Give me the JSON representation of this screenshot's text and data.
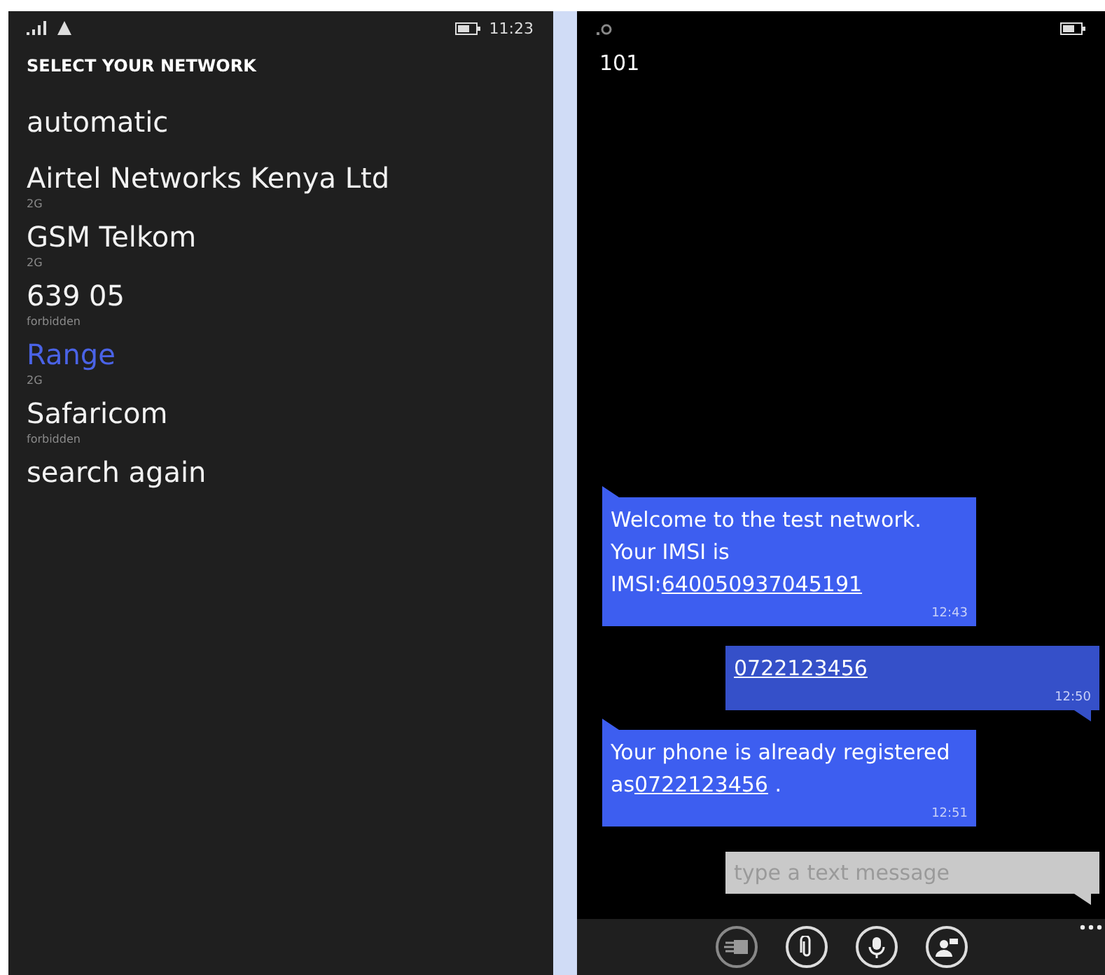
{
  "network_screen": {
    "status_bar": {
      "time": "11:23"
    },
    "title": "SELECT YOUR NETWORK",
    "networks": [
      {
        "name": "automatic",
        "selected": false
      },
      {
        "name": "Airtel Networks Kenya Ltd",
        "sub": "2G",
        "selected": false
      },
      {
        "name": "GSM Telkom",
        "sub": "2G",
        "selected": false
      },
      {
        "name": "639 05",
        "sub": "forbidden",
        "selected": false
      },
      {
        "name": "Range",
        "sub": "2G",
        "selected": true
      },
      {
        "name": "Safaricom",
        "sub": "forbidden",
        "selected": false
      },
      {
        "name": "search again",
        "selected": false
      }
    ]
  },
  "messaging_screen": {
    "contact": "101",
    "messages": [
      {
        "kind": "incoming",
        "text": "Welcome to the test network. Your IMSI is IMSI:",
        "link": "640050937045191",
        "time": "12:43"
      },
      {
        "kind": "outgoing",
        "link": "0722123456",
        "time": "12:50"
      },
      {
        "kind": "incoming",
        "text": "Your phone is already registered as",
        "link": "0722123456",
        "after": " .",
        "time": "12:51"
      }
    ],
    "compose": {
      "placeholder": "type a text message"
    }
  }
}
